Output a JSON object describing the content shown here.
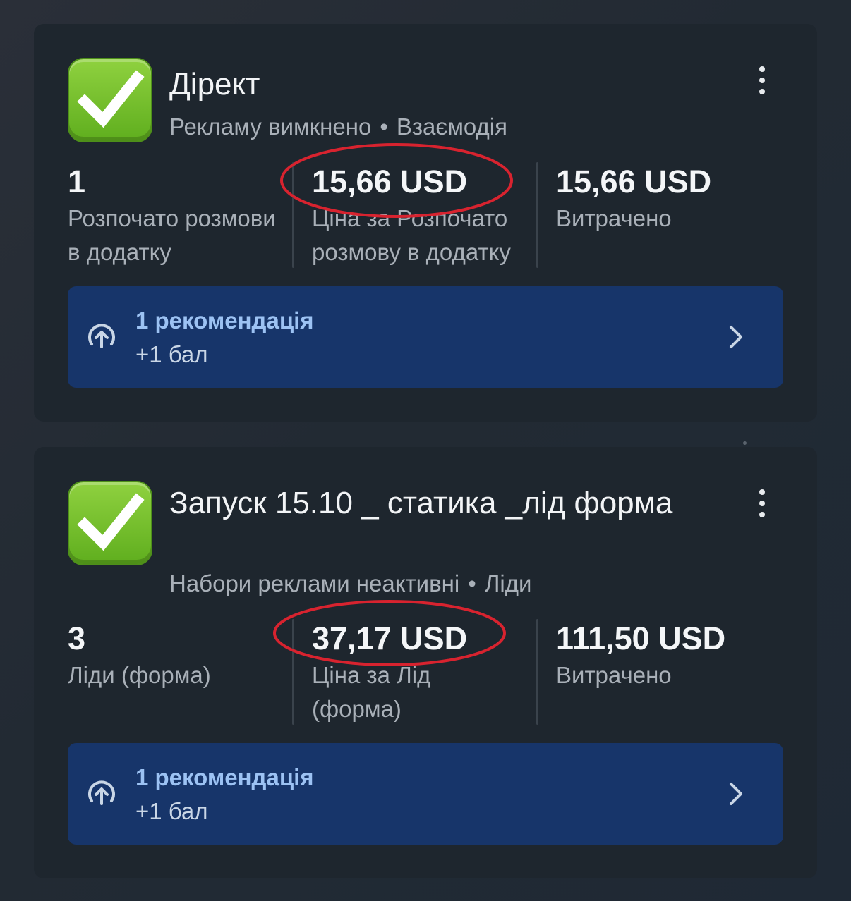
{
  "cards": [
    {
      "title": "Дірект",
      "status": "Рекламу вимкнено",
      "objective": "Взаємодія",
      "separator": "•",
      "metrics": [
        {
          "value": "1",
          "label": "Розпочато розмови в додатку"
        },
        {
          "value": "15,66 USD",
          "label": "Ціна за Розпочато розмову в додатку"
        },
        {
          "value": "15,66 USD",
          "label": "Витрачено"
        }
      ],
      "recommendation": {
        "title": "1 рекомендація",
        "subtitle": "+1 бал"
      }
    },
    {
      "title": "Запуск 15.10 _ статика _лід форма",
      "status": "Набори реклами неактивні",
      "objective": "Ліди",
      "separator": "•",
      "metrics": [
        {
          "value": "3",
          "label": "Ліди (форма)"
        },
        {
          "value": "37,17 USD",
          "label": "Ціна за Лід (форма)"
        },
        {
          "value": "111,50 USD",
          "label": "Витрачено"
        }
      ],
      "recommendation": {
        "title": "1 рекомендація",
        "subtitle": "+1 бал"
      }
    }
  ],
  "icons": {
    "status_check": "check-mark-button-icon",
    "more": "more-vertical-icon",
    "recommendation": "arrow-up-circle-icon",
    "open": "chevron-right-icon"
  },
  "colors": {
    "card_bg": "#1e262e",
    "recommendation_bg": "#17356a",
    "recommendation_title": "#9cc2f3",
    "highlight_circle": "#d8232f",
    "check_green": "#6fbf2a"
  }
}
